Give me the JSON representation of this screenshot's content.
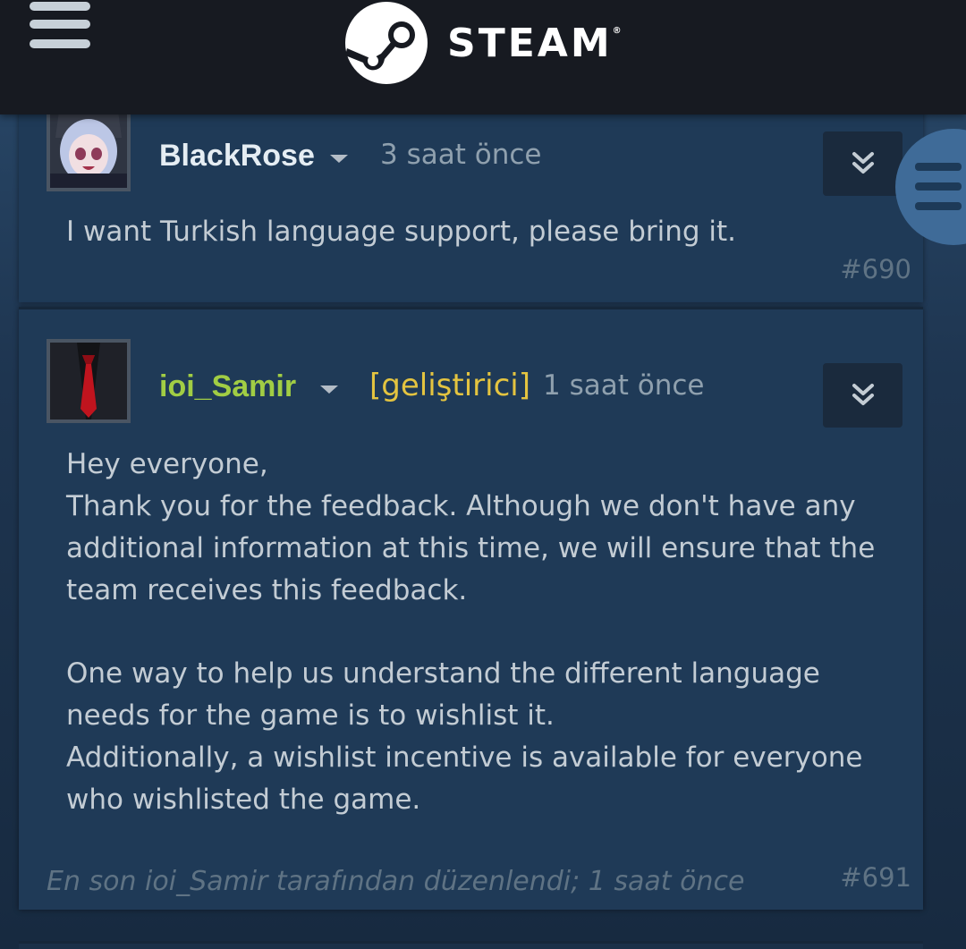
{
  "header": {
    "menu_icon": "hamburger-icon",
    "logo_icon": "steam-logo-icon",
    "logo_text": "STEAM",
    "logo_reg": "®"
  },
  "posts": [
    {
      "author": "BlackRose",
      "time": "3 saat önce",
      "body": "I want Turkish language support, please bring it.",
      "number": "#690"
    },
    {
      "author": "ioi_Samir",
      "role": "[geliştirici]",
      "time": "1 saat önce",
      "body_lines": [
        "Hey everyone,",
        "Thank you for the feedback. Although we don't have any additional information at this time, we will ensure that the team receives this feedback.",
        "One way to help us understand the different language needs for the game is to wishlist it.",
        "Additionally, a wishlist incentive is available for everyone who wishlisted the game."
      ],
      "edited_prefix": "En son ",
      "edited_author": "ioi_Samir",
      "edited_suffix": " tarafından düzenlendi; 1 saat önce",
      "number": "#691"
    }
  ],
  "colors": {
    "topbar": "#171a21",
    "card": "#1f3a57",
    "developer_name": "#a1cd44",
    "developer_tag": "#e4c440"
  }
}
